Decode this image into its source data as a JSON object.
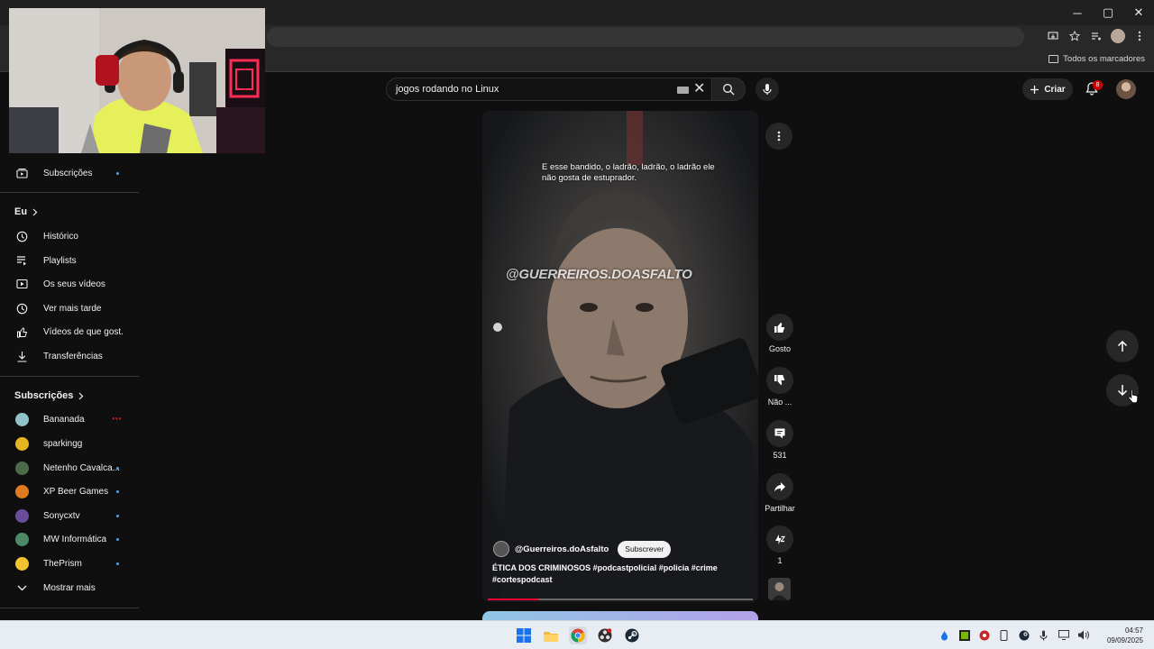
{
  "browser": {
    "bookmarks_all": "Todos os marcadores",
    "window_controls": {
      "minimize": "─",
      "maximize": "▢",
      "close": "✕"
    }
  },
  "youtube": {
    "search": {
      "query": "jogos rodando no Linux"
    },
    "create_label": "Criar",
    "notification_count": "8"
  },
  "sidebar": {
    "subscriptions_top": "Subscrições",
    "you_heading": "Eu",
    "you_items": [
      {
        "label": "Histórico",
        "icon": "history-icon"
      },
      {
        "label": "Playlists",
        "icon": "playlists-icon"
      },
      {
        "label": "Os seus vídeos",
        "icon": "your-videos-icon"
      },
      {
        "label": "Ver mais tarde",
        "icon": "watch-later-icon"
      },
      {
        "label": "Vídeos de que gost...",
        "icon": "liked-videos-icon"
      },
      {
        "label": "Transferências",
        "icon": "downloads-icon"
      }
    ],
    "subs_heading": "Subscrições",
    "channels": [
      {
        "name": "Bananada",
        "color": "#8fc3c9",
        "live": true
      },
      {
        "name": "sparkingg",
        "color": "#e7b520",
        "live": false
      },
      {
        "name": "Netenho Cavalca...",
        "color": "#4a6a4a",
        "live": false
      },
      {
        "name": "XP Beer Games",
        "color": "#e07a1f",
        "live": false
      },
      {
        "name": "Sonycxtv",
        "color": "#6a4c9c",
        "live": false
      },
      {
        "name": "MW Informática",
        "color": "#4c8a6a",
        "live": false
      },
      {
        "name": "ThePrism",
        "color": "#f4c430",
        "live": false
      }
    ],
    "show_more": "Mostrar mais"
  },
  "short": {
    "caption": "E esse bandido, o ladrão, ladrão, o ladrão ele não gosta de estuprador.",
    "watermark": "@GUERREIROS.DOASFALTO",
    "channel": "@Guerreiros.doAsfalto",
    "subscribe": "Subscrever",
    "title": "ÉTICA DOS CRIMINOSOS #podcastpolicial #policia #crime #cortespodcast",
    "progress": 0.19
  },
  "actions": {
    "like": "Gosto",
    "dislike": "Não ...",
    "comments": "531",
    "share": "Partilhar",
    "remix": "1"
  },
  "taskbar": {
    "time": "04:57",
    "date": "09/09/2025"
  }
}
